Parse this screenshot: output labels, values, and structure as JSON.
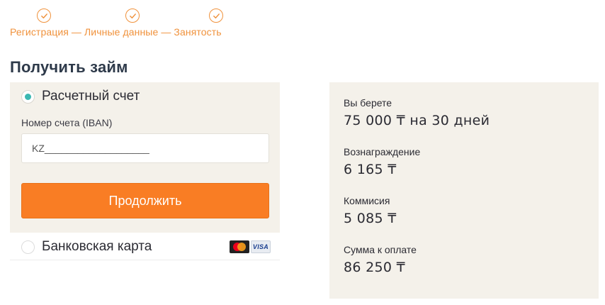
{
  "stepper": {
    "text": "Регистрация — Личные данные — Занятость",
    "steps": [
      "Регистрация",
      "Личные данные",
      "Занятость"
    ],
    "accent_color": "#f0923c",
    "icon": "check-circle-icon"
  },
  "page": {
    "title": "Получить займ"
  },
  "payout": {
    "account_option": {
      "label": "Расчетный счет",
      "selected": true
    },
    "iban": {
      "label": "Номер счета (IBAN)",
      "value": "",
      "placeholder": "KZ___________________"
    },
    "continue_label": "Продолжить",
    "card_option": {
      "label": "Банковская карта",
      "selected": false,
      "logos": [
        "mastercard-logo",
        "visa-logo"
      ],
      "visa_text": "VISA"
    }
  },
  "summary": {
    "items": [
      {
        "label": "Вы берете",
        "value": "75 000 ₸ на 30 дней"
      },
      {
        "label": "Вознаграждение",
        "value": "6 165 ₸"
      },
      {
        "label": "Коммисия",
        "value": "5 085 ₸"
      },
      {
        "label": "Сумма к оплате",
        "value": "86 250 ₸"
      }
    ]
  },
  "colors": {
    "accent": "#f97d24",
    "radio": "#3bb8b2",
    "panel": "#f4f1ea"
  }
}
